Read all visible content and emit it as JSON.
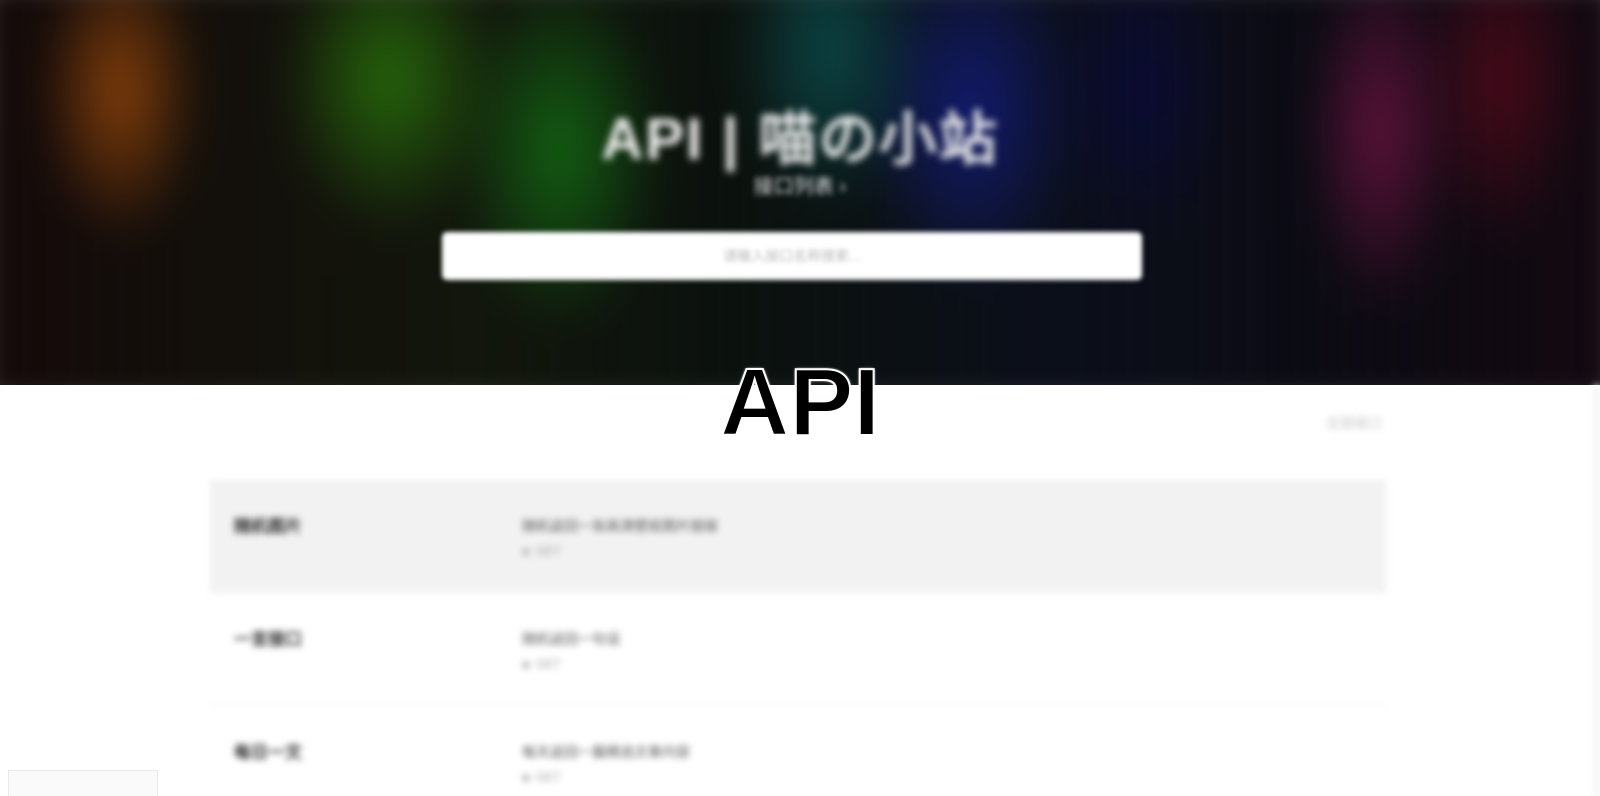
{
  "hero": {
    "title": "API | 喵の小站",
    "subtitle": "接口列表 ›",
    "search_placeholder": "请输入接口名称搜索..."
  },
  "watermark": {
    "text": "API"
  },
  "toolbar": {
    "link_label": "全部接口"
  },
  "api_list": [
    {
      "name": "随机图片",
      "description": "随机返回一张高清壁纸图片链接",
      "meta": "GET",
      "highlighted": true
    },
    {
      "name": "一言接口",
      "description": "随机返回一句话",
      "meta": "GET",
      "highlighted": false
    },
    {
      "name": "每日一文",
      "description": "每天返回一篇精选文章内容",
      "meta": "GET",
      "highlighted": false
    }
  ],
  "colors": {
    "hero_dark": "#0b0f1a",
    "row_highlight": "#f2f2f2",
    "watermark": "#000000"
  }
}
